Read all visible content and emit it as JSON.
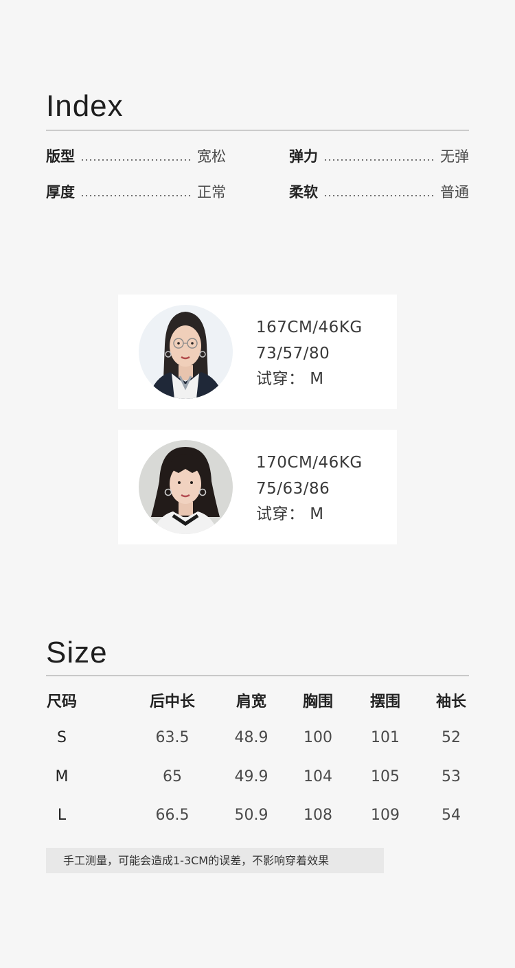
{
  "index": {
    "title": "Index",
    "rows": [
      [
        {
          "label": "版型",
          "value": "宽松"
        },
        {
          "label": "弹力",
          "value": "无弹"
        }
      ],
      [
        {
          "label": "厚度",
          "value": "正常"
        },
        {
          "label": "柔软",
          "value": "普通"
        }
      ]
    ]
  },
  "models": [
    {
      "line1": "167CM/46KG",
      "line2": "73/57/80",
      "line3": "试穿：  M"
    },
    {
      "line1": "170CM/46KG",
      "line2": "75/63/86",
      "line3": "试穿：  M"
    }
  ],
  "size": {
    "title": "Size",
    "headers": [
      "尺码",
      "后中长",
      "肩宽",
      "胸围",
      "摆围",
      "袖长"
    ],
    "rows": [
      [
        "S",
        "63.5",
        "48.9",
        "100",
        "101",
        "52"
      ],
      [
        "M",
        "65",
        "49.9",
        "104",
        "105",
        "53"
      ],
      [
        "L",
        "66.5",
        "50.9",
        "108",
        "109",
        "54"
      ]
    ],
    "note": "手工测量，可能会造成1-3CM的误差，不影响穿着效果"
  }
}
